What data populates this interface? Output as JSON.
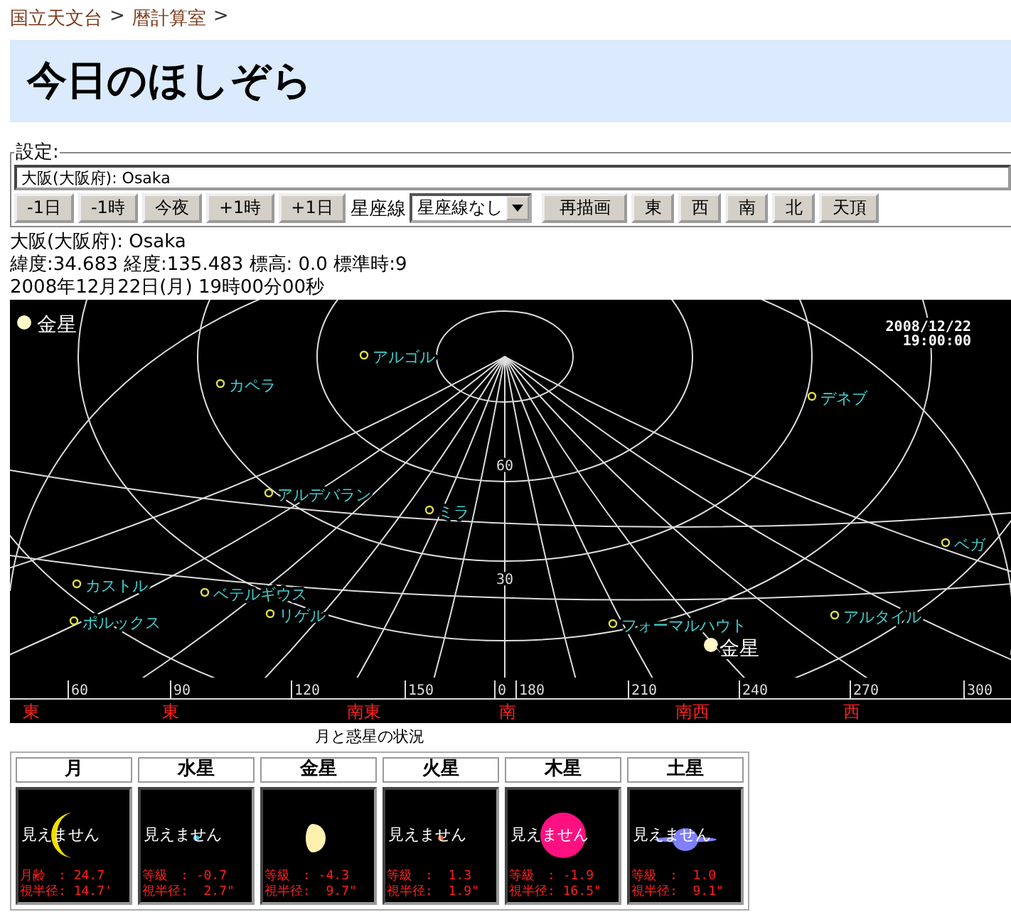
{
  "breadcrumb": [
    {
      "label": "国立天文台"
    },
    {
      "label": "暦計算室"
    }
  ],
  "breadcrumb_separator": ">",
  "title": "今日のほしぞら",
  "settings": {
    "legend": "設定:",
    "location_value": "大阪(大阪府): Osaka",
    "buttons": [
      {
        "label": "-1日"
      },
      {
        "label": "-1時"
      },
      {
        "label": "今夜"
      },
      {
        "label": "+1時"
      },
      {
        "label": "+1日"
      }
    ],
    "constellation_label": "星座線",
    "constellation_select": "星座線なし",
    "redraw": "再描画",
    "direction_buttons": [
      {
        "label": "東"
      },
      {
        "label": "西"
      },
      {
        "label": "南"
      },
      {
        "label": "北"
      },
      {
        "label": "天頂"
      }
    ]
  },
  "info": {
    "place": "大阪(大阪府): Osaka",
    "coords": "緯度:34.683 経度:135.483 標高: 0.0 標準時:9",
    "datetime": "2008年12月22日(月) 19時00分00秒"
  },
  "sky": {
    "legend": "金星",
    "date": "2008/12/22",
    "time": "19:00:00",
    "stars": [
      {
        "name": "アルゴル"
      },
      {
        "name": "カペラ"
      },
      {
        "name": "デネブ"
      },
      {
        "name": "アルデバラン"
      },
      {
        "name": "ミラ"
      },
      {
        "name": "ベガ"
      },
      {
        "name": "カストル"
      },
      {
        "name": "ベテルギウス"
      },
      {
        "name": "リゲル"
      },
      {
        "name": "ポルックス"
      },
      {
        "name": "フォーマルハウト"
      },
      {
        "name": "アルタイル"
      }
    ],
    "planet_label": "金星",
    "altitude_labels": [
      "60",
      "30"
    ],
    "azimuth_labels": [
      "60",
      "90",
      "120",
      "150",
      "0",
      "180",
      "210",
      "240",
      "270",
      "300"
    ],
    "directions": [
      "東",
      "東",
      "南東",
      "南",
      "南西",
      "西"
    ]
  },
  "caption": "月と惑星の状況",
  "planets": [
    {
      "name": "月",
      "kind": "crescent",
      "color": "#f0e000",
      "status": "見えません",
      "line_1": "月齢　: 24.7",
      "line_2": "視半径: 14.7'"
    },
    {
      "name": "水星",
      "kind": "dot",
      "color": "#40c0e0",
      "status": "見えません",
      "line_1": "等級　: -0.7",
      "line_2": "視半径:  2.7\""
    },
    {
      "name": "金星",
      "kind": "gibbous",
      "color": "#fff0b0",
      "line_1": "等級　: -4.3",
      "line_2": "視半径:  9.7\""
    },
    {
      "name": "火星",
      "kind": "dot",
      "color": "#e06030",
      "status": "見えません",
      "line_1": "等級　:  1.3",
      "line_2": "視半径:  1.9\""
    },
    {
      "name": "木星",
      "kind": "disk",
      "color": "#ff1080",
      "status": "見えません",
      "line_1": "等級　: -1.9",
      "line_2": "視半径: 16.5\""
    },
    {
      "name": "土星",
      "kind": "ringed",
      "color": "#8080ff",
      "status": "見えません",
      "line_1": "等級　:  1.0",
      "line_2": "視半径:  9.1\""
    }
  ]
}
